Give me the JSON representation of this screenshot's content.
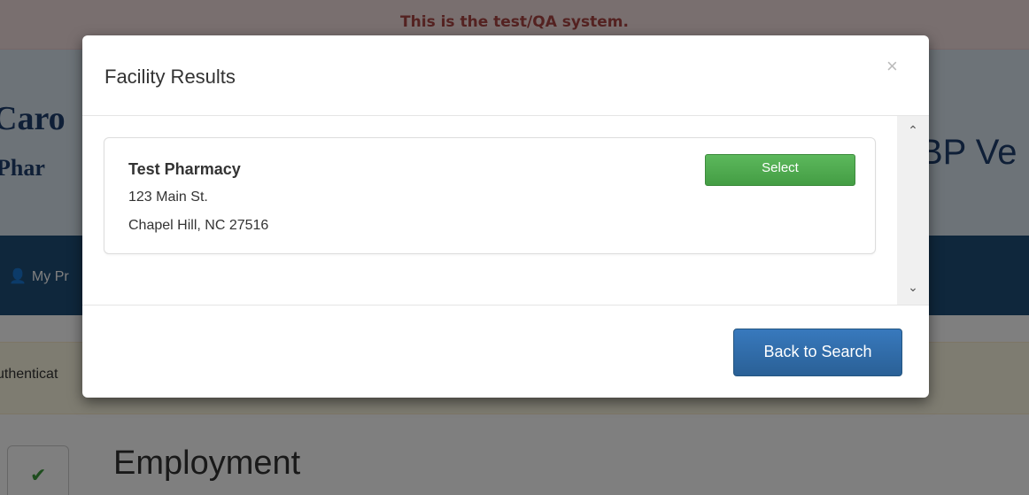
{
  "banner": {
    "text": "This is the test/QA system."
  },
  "background": {
    "brand_line1": "Caro",
    "brand_line2": "Phar",
    "header_right": "BP Ve",
    "nav_item": "My Pr",
    "alert_text": "uthenticat",
    "section_heading": "Employment",
    "check_icon": "✔",
    "person_icon": "👤"
  },
  "modal": {
    "title": "Facility Results",
    "close_icon": "×",
    "scroll_up_icon": "⌃",
    "scroll_down_icon": "⌄",
    "results": [
      {
        "name": "Test Pharmacy",
        "street": "123 Main St.",
        "city_state_zip": "Chapel Hill, NC 27516",
        "select_label": "Select"
      }
    ],
    "back_button_label": "Back to Search"
  },
  "colors": {
    "banner_bg": "#f2dede",
    "banner_text": "#a94442",
    "navbar_bg": "#1f4e79",
    "select_button": "#5cb85c",
    "primary_button": "#337ab7"
  }
}
